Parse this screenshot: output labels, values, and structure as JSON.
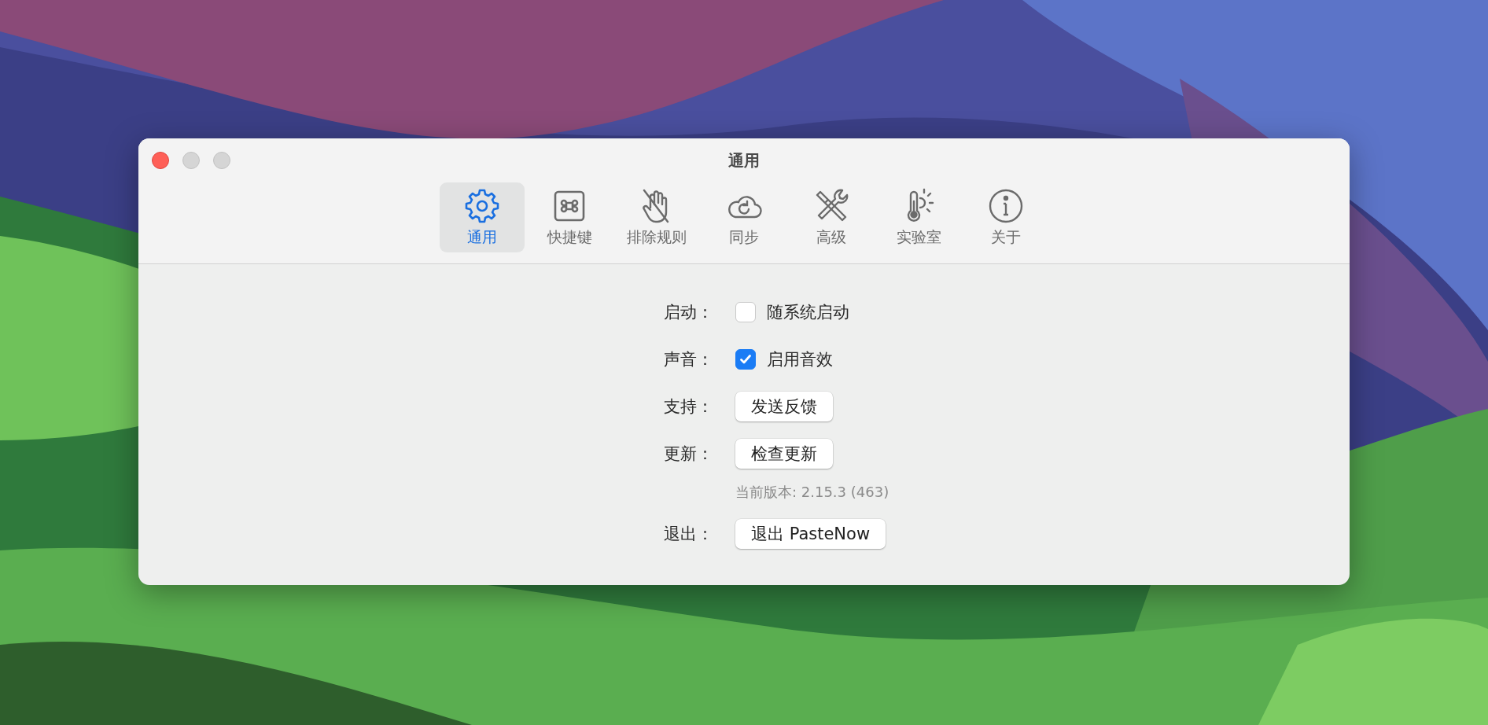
{
  "window": {
    "title": "通用"
  },
  "tabs": [
    {
      "label": "通用",
      "selected": true
    },
    {
      "label": "快捷键",
      "selected": false
    },
    {
      "label": "排除规则",
      "selected": false
    },
    {
      "label": "同步",
      "selected": false
    },
    {
      "label": "高级",
      "selected": false
    },
    {
      "label": "实验室",
      "selected": false
    },
    {
      "label": "关于",
      "selected": false
    }
  ],
  "settings": [
    {
      "kind": "checkbox",
      "label": "启动：",
      "text": "随系统启动",
      "checked": false
    },
    {
      "kind": "checkbox",
      "label": "声音：",
      "text": "启用音效",
      "checked": true
    },
    {
      "kind": "button",
      "label": "支持：",
      "button": "发送反馈"
    },
    {
      "kind": "button",
      "label": "更新：",
      "button": "检查更新"
    },
    {
      "kind": "note",
      "text": "当前版本: 2.15.3 (463)"
    },
    {
      "kind": "button",
      "label": "退出：",
      "button": "退出 PasteNow"
    }
  ]
}
